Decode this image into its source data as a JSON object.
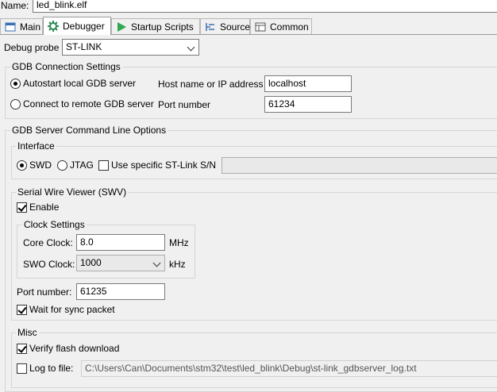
{
  "name": {
    "label": "Name:",
    "value": "led_blink.elf"
  },
  "tabs": [
    {
      "label": "Main",
      "icon": "main-tab-icon"
    },
    {
      "label": "Debugger",
      "icon": "debugger-gear-icon",
      "active": true
    },
    {
      "label": "Startup Scripts",
      "icon": "play-icon"
    },
    {
      "label": "Source",
      "icon": "source-icon"
    },
    {
      "label": "Common",
      "icon": "common-icon"
    }
  ],
  "debug_probe": {
    "label": "Debug probe",
    "value": "ST-LINK"
  },
  "gdb_connection": {
    "title": "GDB Connection Settings",
    "autostart_label": "Autostart local GDB server",
    "remote_label": "Connect to remote GDB server",
    "host_label": "Host name or IP address",
    "host_value": "localhost",
    "port_label": "Port number",
    "port_value": "61234",
    "selected": "autostart"
  },
  "server_options": {
    "title": "GDB Server Command Line Options",
    "interface": {
      "title": "Interface",
      "swd_label": "SWD",
      "jtag_label": "JTAG",
      "selected": "SWD",
      "specific_sn_label": "Use specific ST-Link S/N",
      "specific_sn_checked": false
    },
    "swv": {
      "title": "Serial Wire Viewer (SWV)",
      "enable_label": "Enable",
      "enable_checked": true,
      "clock": {
        "title": "Clock Settings",
        "core_label": "Core Clock:",
        "core_value": "8.0",
        "core_unit": "MHz",
        "swo_label": "SWO Clock:",
        "swo_value": "1000",
        "swo_unit": "kHz"
      },
      "port_label": "Port number:",
      "port_value": "61235",
      "wait_sync_label": "Wait for sync packet",
      "wait_sync_checked": true
    },
    "misc": {
      "title": "Misc",
      "verify_label": "Verify flash download",
      "verify_checked": true,
      "log_label": "Log to file:",
      "log_checked": false,
      "log_path": "C:\\Users\\Can\\Documents\\stm32\\test\\led_blink\\Debug\\st-link_gdbserver_log.txt"
    }
  }
}
